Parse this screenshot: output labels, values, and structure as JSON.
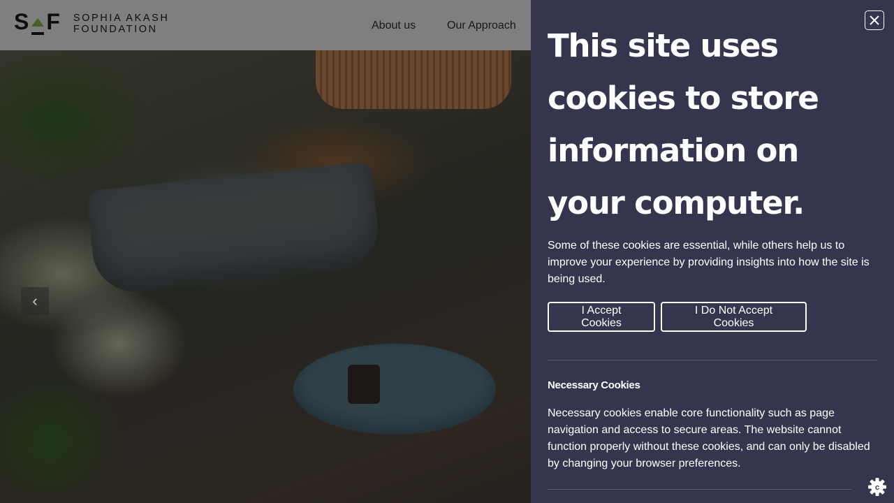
{
  "header": {
    "logo_letters": "S F",
    "logo_name_line1": "SOPHIA AKASH",
    "logo_name_line2": "FOUNDATION",
    "nav": [
      {
        "label": "About us"
      },
      {
        "label": "Our Approach"
      }
    ]
  },
  "hero": {
    "prev_icon": "chevron-left-icon",
    "prev_glyph": "‹"
  },
  "cookie_panel": {
    "title": "This site uses cookies to store information on your computer.",
    "intro": "Some of these cookies are essential, while others help us to improve your experience by providing insights into how the site is being used.",
    "accept_label": "I Accept Cookies",
    "decline_label": "I Do Not Accept Cookies",
    "necessary": {
      "title": "Necessary Cookies",
      "body": "Necessary cookies enable core functionality such as page navigation and access to secure areas. The website cannot function properly without these cookies, and can only be disabled by changing your browser preferences."
    },
    "close_icon": "close-icon",
    "settings_icon": "cookie-gear-icon"
  },
  "colors": {
    "panel_bg": "#35354d",
    "logo_accent": "#8bc34a",
    "settings_bg": "#35354d"
  }
}
